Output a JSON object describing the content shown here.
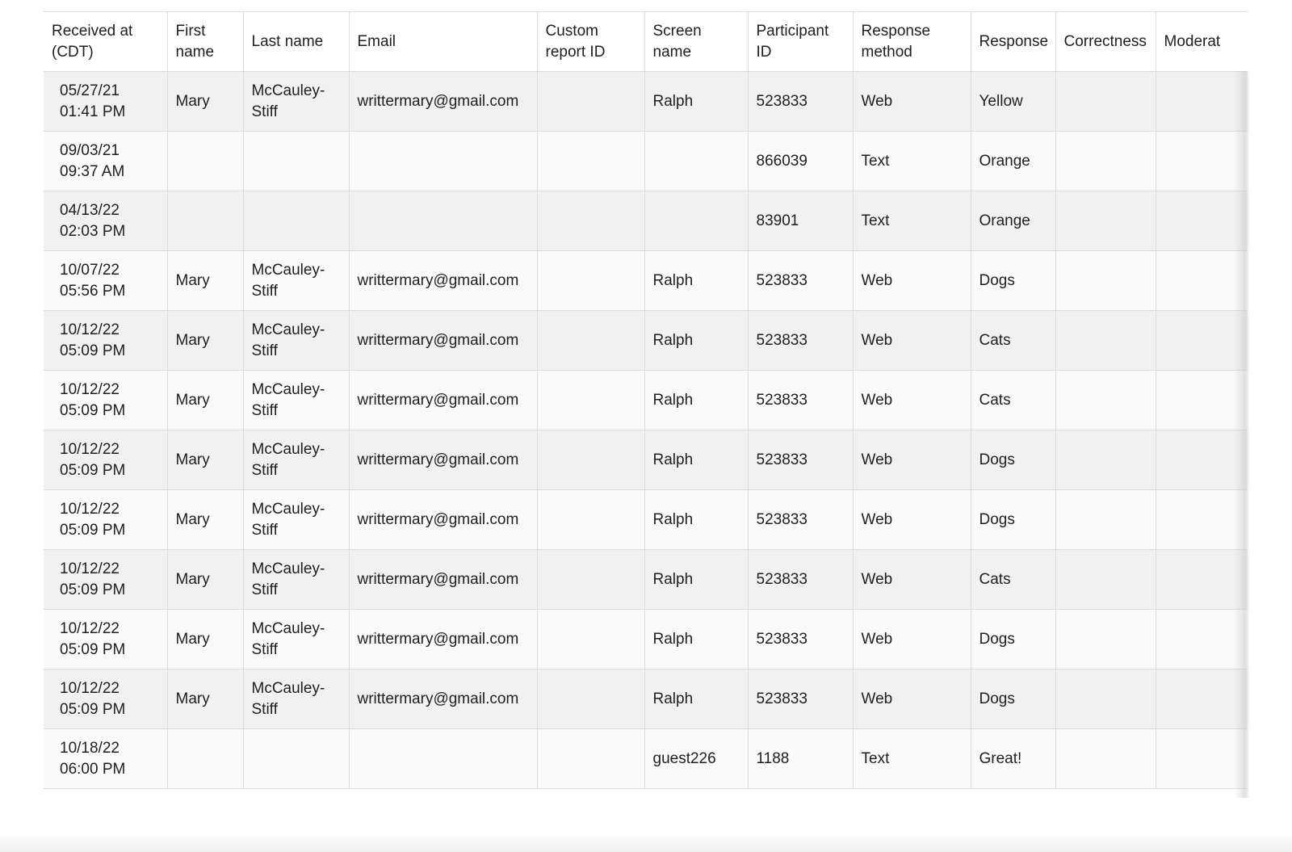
{
  "table": {
    "columns": [
      "Received at (CDT)",
      "First name",
      "Last name",
      "Email",
      "Custom report ID",
      "Screen name",
      "Participant ID",
      "Response method",
      "Response",
      "Correctness",
      "Moderat"
    ],
    "rows": [
      {
        "received": "05/27/21 01:41 PM",
        "first": "Mary",
        "last": "McCauley-Stiff",
        "email": "writtermary@gmail.com",
        "custom_id": "",
        "screen": "Ralph",
        "participant": "523833",
        "method": "Web",
        "response": "Yellow",
        "correctness": "",
        "moderation": ""
      },
      {
        "received": "09/03/21 09:37 AM",
        "first": "",
        "last": "",
        "email": "",
        "custom_id": "",
        "screen": "",
        "participant": "866039",
        "method": "Text",
        "response": "Orange",
        "correctness": "",
        "moderation": ""
      },
      {
        "received": "04/13/22 02:03 PM",
        "first": "",
        "last": "",
        "email": "",
        "custom_id": "",
        "screen": "",
        "participant": "83901",
        "method": "Text",
        "response": "Orange",
        "correctness": "",
        "moderation": ""
      },
      {
        "received": "10/07/22 05:56 PM",
        "first": "Mary",
        "last": "McCauley-Stiff",
        "email": "writtermary@gmail.com",
        "custom_id": "",
        "screen": "Ralph",
        "participant": "523833",
        "method": "Web",
        "response": "Dogs",
        "correctness": "",
        "moderation": ""
      },
      {
        "received": "10/12/22 05:09 PM",
        "first": "Mary",
        "last": "McCauley-Stiff",
        "email": "writtermary@gmail.com",
        "custom_id": "",
        "screen": "Ralph",
        "participant": "523833",
        "method": "Web",
        "response": "Cats",
        "correctness": "",
        "moderation": ""
      },
      {
        "received": "10/12/22 05:09 PM",
        "first": "Mary",
        "last": "McCauley-Stiff",
        "email": "writtermary@gmail.com",
        "custom_id": "",
        "screen": "Ralph",
        "participant": "523833",
        "method": "Web",
        "response": "Cats",
        "correctness": "",
        "moderation": ""
      },
      {
        "received": "10/12/22 05:09 PM",
        "first": "Mary",
        "last": "McCauley-Stiff",
        "email": "writtermary@gmail.com",
        "custom_id": "",
        "screen": "Ralph",
        "participant": "523833",
        "method": "Web",
        "response": "Dogs",
        "correctness": "",
        "moderation": ""
      },
      {
        "received": "10/12/22 05:09 PM",
        "first": "Mary",
        "last": "McCauley-Stiff",
        "email": "writtermary@gmail.com",
        "custom_id": "",
        "screen": "Ralph",
        "participant": "523833",
        "method": "Web",
        "response": "Dogs",
        "correctness": "",
        "moderation": ""
      },
      {
        "received": "10/12/22 05:09 PM",
        "first": "Mary",
        "last": "McCauley-Stiff",
        "email": "writtermary@gmail.com",
        "custom_id": "",
        "screen": "Ralph",
        "participant": "523833",
        "method": "Web",
        "response": "Cats",
        "correctness": "",
        "moderation": ""
      },
      {
        "received": "10/12/22 05:09 PM",
        "first": "Mary",
        "last": "McCauley-Stiff",
        "email": "writtermary@gmail.com",
        "custom_id": "",
        "screen": "Ralph",
        "participant": "523833",
        "method": "Web",
        "response": "Dogs",
        "correctness": "",
        "moderation": ""
      },
      {
        "received": "10/12/22 05:09 PM",
        "first": "Mary",
        "last": "McCauley-Stiff",
        "email": "writtermary@gmail.com",
        "custom_id": "",
        "screen": "Ralph",
        "participant": "523833",
        "method": "Web",
        "response": "Dogs",
        "correctness": "",
        "moderation": ""
      },
      {
        "received": "10/18/22 06:00 PM",
        "first": "",
        "last": "",
        "email": "",
        "custom_id": "",
        "screen": "guest226",
        "participant": "1188",
        "method": "Text",
        "response": "Great!",
        "correctness": "",
        "moderation": ""
      }
    ]
  }
}
